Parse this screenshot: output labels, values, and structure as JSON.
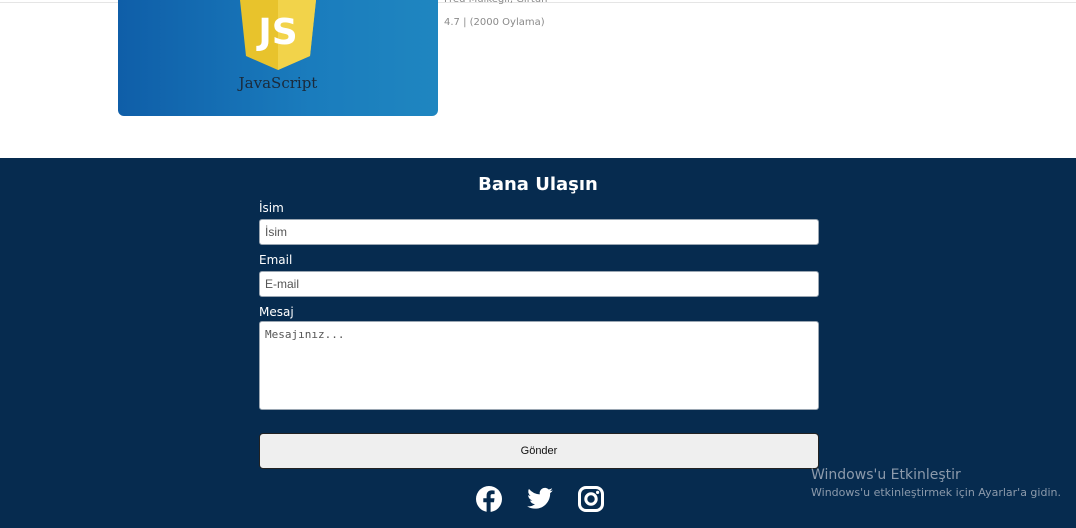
{
  "course": {
    "thumbnail_text": "JavaScript",
    "shield_text": "JS",
    "author": "Fred Mülkeğil, Girtün",
    "rating": "4.7 | (2000 Oylama)"
  },
  "contact": {
    "title": "Bana Ulaşın",
    "name_label": "İsim",
    "name_placeholder": "İsim",
    "email_label": "Email",
    "email_placeholder": "E-mail",
    "message_label": "Mesaj",
    "message_placeholder": "Mesajınız...",
    "submit_label": "Gönder"
  },
  "social": [
    "facebook-icon",
    "twitter-icon",
    "instagram-icon"
  ],
  "watermark": {
    "title": "Windows'u Etkinleştir",
    "subtitle": "Windows'u etkinleştirmek için Ayarlar'a gidin."
  },
  "colors": {
    "section_bg": "#062b4f",
    "js_yellow": "#e8c32c"
  }
}
